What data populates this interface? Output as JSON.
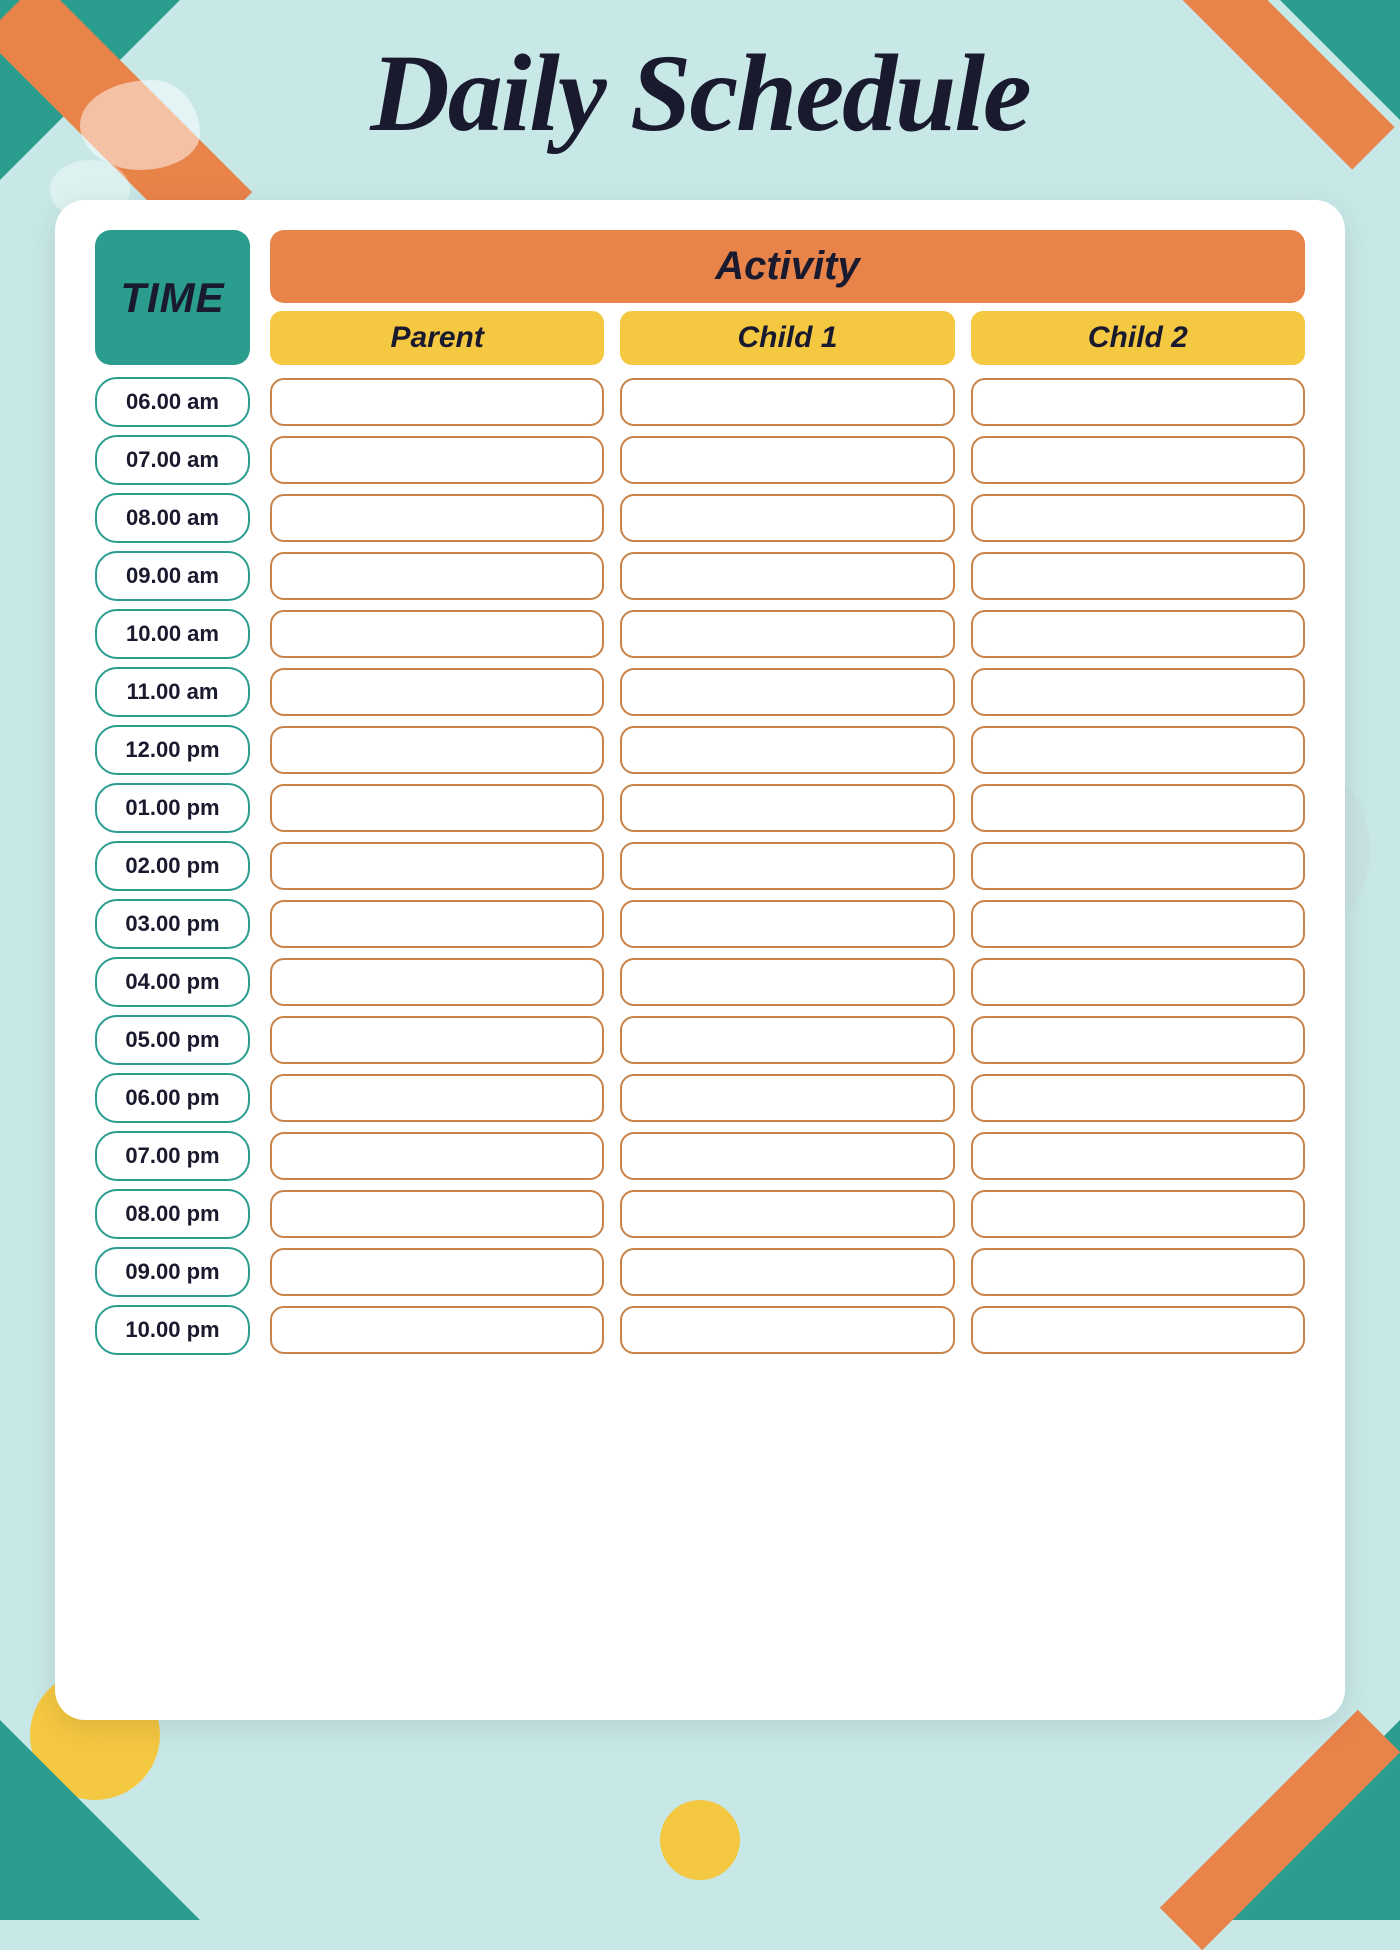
{
  "title": "Daily Schedule",
  "header": {
    "time_label": "TIME",
    "activity_label": "Activity",
    "sub_headers": [
      "Parent",
      "Child 1",
      "Child 2"
    ]
  },
  "time_slots": [
    "06.00 am",
    "07.00 am",
    "08.00 am",
    "09.00 am",
    "10.00 am",
    "11.00 am",
    "12.00 pm",
    "01.00 pm",
    "02.00 pm",
    "03.00 pm",
    "04.00 pm",
    "05.00 pm",
    "06.00 pm",
    "07.00 pm",
    "08.00 pm",
    "09.00 pm",
    "10.00 pm"
  ]
}
